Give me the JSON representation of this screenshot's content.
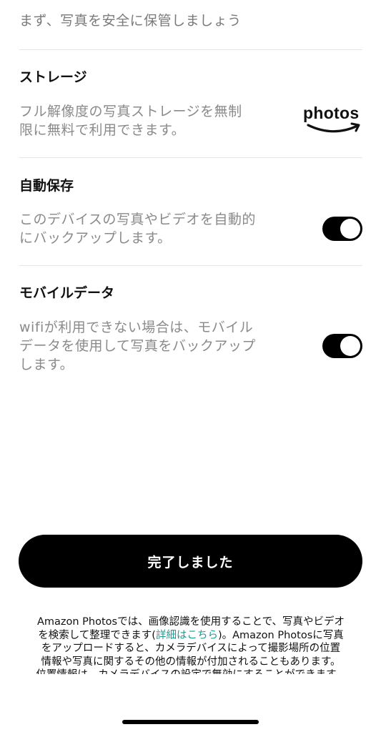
{
  "intro": {
    "text": "まず、写真を安全に保管しましょう"
  },
  "sections": {
    "storage": {
      "title": "ストレージ",
      "desc_line1": "フル解像度の写真ストレージを無制",
      "desc_line2": "限に無料で利用できます。",
      "logo_text": "photos"
    },
    "auto_save": {
      "title": "自動保存",
      "desc_line1": "このデバイスの写真やビデオを自動的",
      "desc_line2": "にバックアップします。",
      "enabled": true
    },
    "mobile_data": {
      "title": "モバイルデータ",
      "desc_line1": "wifiが利用できない場合は、モバイル",
      "desc_line2": "データを使用して写真をバックアップ",
      "desc_line3": "します。",
      "enabled": true
    }
  },
  "done_button": {
    "label": "完了しました"
  },
  "disclaimer": {
    "line1": "Amazon Photosでは、画像認識を使用することで、写真やビデオ",
    "line2_before": "を検索して整理できます(",
    "line2_link": "詳細はこちら",
    "line2_after": ")。Amazon Photosに写真",
    "line3": "をアップロードすると、カメラデバイスによって撮影場所の位置",
    "line4": "情報や写真に関するその他の情報が付加されることもあります。",
    "line5": "位置情報は、カメラデバイスの設定で無効にすることができます。"
  },
  "colors": {
    "accent": "#000000",
    "link": "#1e9b95",
    "secondary_text": "#8a8a8a",
    "divider": "#e5e5e5"
  }
}
